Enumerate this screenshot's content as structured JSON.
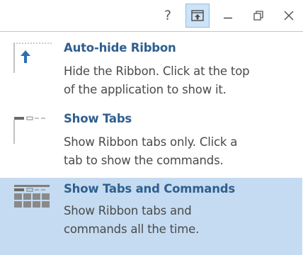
{
  "titlebar": {
    "help_glyph": "?",
    "buttons": [
      {
        "name": "help",
        "label": "?"
      },
      {
        "name": "ribbon-display-options",
        "active": true
      },
      {
        "name": "minimize"
      },
      {
        "name": "restore"
      },
      {
        "name": "close"
      }
    ]
  },
  "menu": {
    "items": [
      {
        "title": "Auto-hide Ribbon",
        "line1": "Hide the Ribbon. Click at the top",
        "line2": "of the application to show it.",
        "icon": "auto-hide-ribbon-icon",
        "selected": false
      },
      {
        "title": "Show Tabs",
        "line1": "Show Ribbon tabs only. Click a",
        "line2": "tab to show the commands.",
        "icon": "show-tabs-icon",
        "selected": false
      },
      {
        "title": "Show Tabs and Commands",
        "line1": "Show Ribbon tabs and",
        "line2": "commands all the time.",
        "icon": "show-tabs-and-commands-icon",
        "selected": true
      }
    ]
  },
  "colors": {
    "title_text": "#2f5f8e",
    "desc_text": "#4a4a4a",
    "selected_bg": "#c5dbf1",
    "active_button_bg": "#cde3f7",
    "icon_arrow": "#2d6fb5"
  }
}
